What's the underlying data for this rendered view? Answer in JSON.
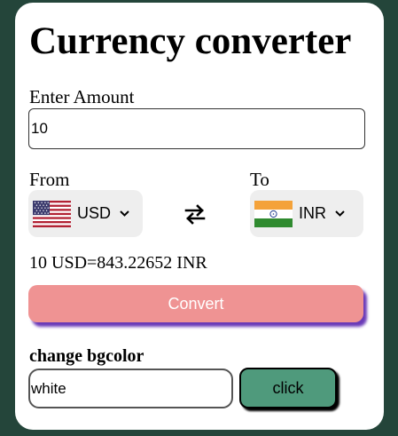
{
  "app": {
    "title": "Currency converter"
  },
  "amount": {
    "label": "Enter Amount",
    "value": "10"
  },
  "from": {
    "label": "From",
    "currency": "USD",
    "flag_icon": "us-flag-icon"
  },
  "to": {
    "label": "To",
    "currency": "INR",
    "flag_icon": "india-flag-icon"
  },
  "swap_icon": "swap-arrows-icon",
  "result": {
    "text": "10 USD=843.22652 INR"
  },
  "convert": {
    "label": "Convert",
    "color": "#ef9393"
  },
  "bgcolor": {
    "label": "change bgcolor",
    "value": "white",
    "button_label": "click",
    "button_color": "#4f9a7c"
  },
  "colors": {
    "page_background": "#24453a",
    "card_background": "#ffffff",
    "select_background": "#eeeeee"
  }
}
